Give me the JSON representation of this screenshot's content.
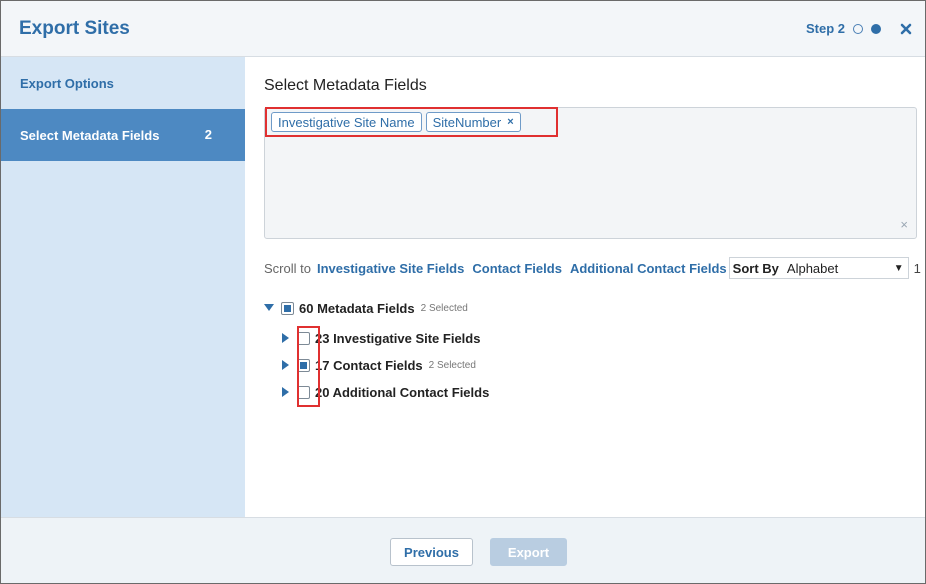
{
  "dialog": {
    "title": "Export Sites",
    "step_label": "Step 2"
  },
  "sidebar": {
    "items": [
      {
        "label": "Export Options"
      },
      {
        "label": "Select Metadata Fields",
        "badge": "2"
      }
    ]
  },
  "main": {
    "title": "Select Metadata Fields",
    "tags": [
      {
        "label": "Investigative Site Name"
      },
      {
        "label": "SiteNumber",
        "remove": "×"
      }
    ],
    "clear_symbol": "×",
    "scroll_to": {
      "label": "Scroll to",
      "links": [
        "Investigative Site Fields",
        "Contact Fields",
        "Additional Contact Fields"
      ]
    },
    "sort": {
      "label": "Sort By",
      "value": "Alphabet",
      "extra": "1"
    },
    "tree": {
      "root": {
        "label": "60 Metadata Fields",
        "sub": "2 Selected",
        "state": "partial"
      },
      "children": [
        {
          "label": "23 Investigative Site Fields",
          "sub": "",
          "state": "unchecked"
        },
        {
          "label": "17 Contact Fields",
          "sub": "2 Selected",
          "state": "partial"
        },
        {
          "label": "20 Additional Contact Fields",
          "sub": "",
          "state": "unchecked"
        }
      ]
    }
  },
  "footer": {
    "previous_label": "Previous",
    "export_label": "Export"
  },
  "colors": {
    "accent": "#2f6ea8",
    "sidebar_bg": "#d6e6f5",
    "sidebar_active": "#4d89c2",
    "highlight": "#e03030"
  }
}
